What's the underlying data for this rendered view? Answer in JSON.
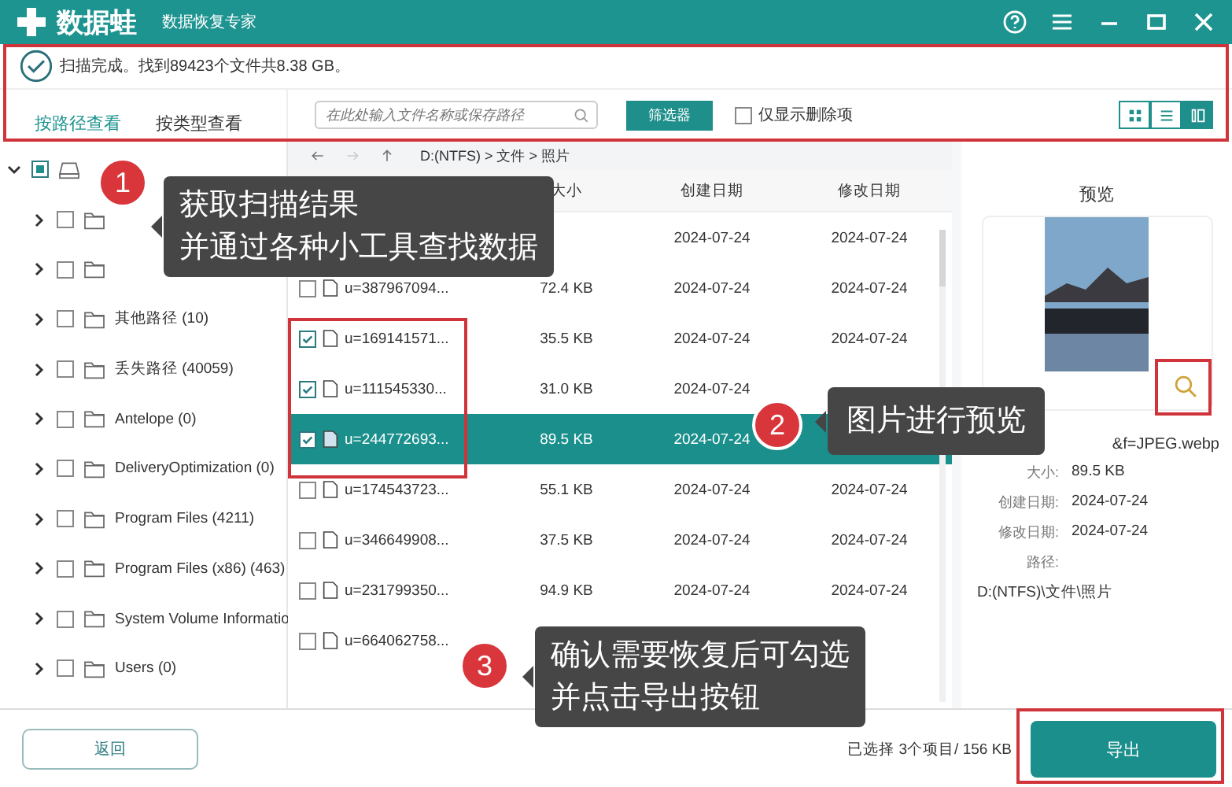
{
  "app": {
    "name": "数据蛙",
    "subtitle": "数据恢复专家"
  },
  "scan": {
    "message": "扫描完成。找到89423个文件共8.38 GB。"
  },
  "view_tabs": [
    {
      "label": "按路径查看",
      "selected": true
    },
    {
      "label": "按类型查看",
      "selected": false
    }
  ],
  "search": {
    "placeholder": "在此处输入文件名称或保存路径"
  },
  "filter_button": "筛选器",
  "deleted_only": {
    "label": "仅显示删除项",
    "checked": false
  },
  "view_modes": [
    {
      "kind": "grid",
      "selected": false
    },
    {
      "kind": "list",
      "selected": false
    },
    {
      "kind": "detail",
      "selected": true
    }
  ],
  "tree": {
    "expanded": true,
    "partial": true,
    "children": [
      {
        "checked": false,
        "expanded": false
      },
      {
        "checked": false,
        "expanded": false
      },
      {
        "label": "其他路径 (10)",
        "checked": false,
        "expanded": false
      },
      {
        "label": "丢失路径 (40059)",
        "checked": false,
        "expanded": false
      },
      {
        "label": "Antelope (0)",
        "checked": false,
        "expanded": false
      },
      {
        "label": "DeliveryOptimization (0)",
        "checked": false,
        "expanded": false
      },
      {
        "label": "Program Files (4211)",
        "checked": false,
        "expanded": false
      },
      {
        "label": "Program Files (x86) (463)",
        "checked": false,
        "expanded": false
      },
      {
        "label": "System Volume Informatio",
        "checked": false,
        "expanded": false
      },
      {
        "label": "Users (0)",
        "checked": false,
        "expanded": false
      }
    ]
  },
  "breadcrumb": "D:(NTFS) > 文件 > 照片",
  "columns": [
    "大小",
    "创建日期",
    "修改日期"
  ],
  "files": [
    {
      "created": "2024-07-24",
      "modified": "2024-07-24",
      "selected": false
    },
    {
      "name": "u=387967094...",
      "size": "72.4 KB",
      "created": "2024-07-24",
      "modified": "2024-07-24",
      "checked": false,
      "selected": false
    },
    {
      "name": "u=169141571...",
      "size": "35.5 KB",
      "created": "2024-07-24",
      "modified": "2024-07-24",
      "checked": true,
      "selected": false
    },
    {
      "name": "u=111545330...",
      "size": "31.0 KB",
      "created": "2024-07-24",
      "checked": true,
      "selected": false
    },
    {
      "name": "u=244772693...",
      "size": "89.5 KB",
      "created": "2024-07-24",
      "checked": true,
      "selected": true
    },
    {
      "name": "u=174543723...",
      "size": "55.1 KB",
      "created": "2024-07-24",
      "modified": "2024-07-24",
      "checked": false,
      "selected": false
    },
    {
      "name": "u=346649908...",
      "size": "37.5 KB",
      "created": "2024-07-24",
      "modified": "2024-07-24",
      "checked": false,
      "selected": false
    },
    {
      "name": "u=231799350...",
      "size": "94.9 KB",
      "created": "2024-07-24",
      "modified": "2024-07-24",
      "checked": false,
      "selected": false
    },
    {
      "name": "u=664062758...",
      "checked": false,
      "selected": false
    }
  ],
  "preview": {
    "title": "预览",
    "filename": "&f=JPEG.webp",
    "info": [
      {
        "label": "大小:",
        "value": "89.5 KB"
      },
      {
        "label": "创建日期:",
        "value": "2024-07-24"
      },
      {
        "label": "修改日期:",
        "value": "2024-07-24"
      }
    ],
    "path_label": "路径:",
    "path": "D:(NTFS)\\文件\\照片"
  },
  "footer": {
    "back": "返回",
    "status": "已选择 3个项目/ 156 KB",
    "export": "导出"
  },
  "callouts": [
    {
      "number": "1",
      "lines": [
        "获取扫描结果",
        "并通过各种小工具查找数据"
      ]
    },
    {
      "number": "2",
      "lines": [
        "图片进行预览"
      ]
    },
    {
      "number": "3",
      "lines": [
        "确认需要恢复后可勾选",
        "并点击导出按钮"
      ]
    }
  ]
}
